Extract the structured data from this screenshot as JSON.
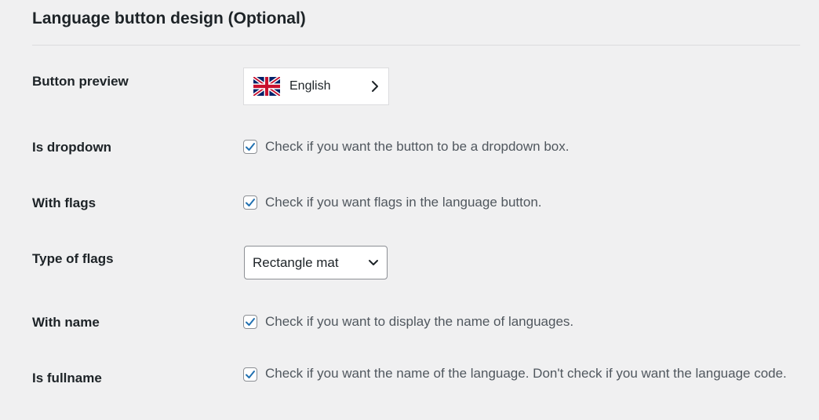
{
  "section": {
    "title": "Language button design (Optional)"
  },
  "rows": {
    "button_preview": {
      "label": "Button preview",
      "preview_language": "English",
      "flag_icon": "uk-flag-icon",
      "arrow_icon": "chevron-right-icon"
    },
    "is_dropdown": {
      "label": "Is dropdown",
      "checked": true,
      "description": "Check if you want the button to be a dropdown box."
    },
    "with_flags": {
      "label": "With flags",
      "checked": true,
      "description": "Check if you want flags in the language button."
    },
    "type_of_flags": {
      "label": "Type of flags",
      "selected": "Rectangle mat",
      "arrow_icon": "chevron-down-icon"
    },
    "with_name": {
      "label": "With name",
      "checked": true,
      "description": "Check if you want to display the name of languages."
    },
    "is_fullname": {
      "label": "Is fullname",
      "checked": true,
      "description": "Check if you want the name of the language. Don't check if you want the language code."
    }
  },
  "colors": {
    "background": "#f0f0f1",
    "checkmark": "#2271b1",
    "text_dark": "#1d2327",
    "text_muted": "#50575e"
  }
}
